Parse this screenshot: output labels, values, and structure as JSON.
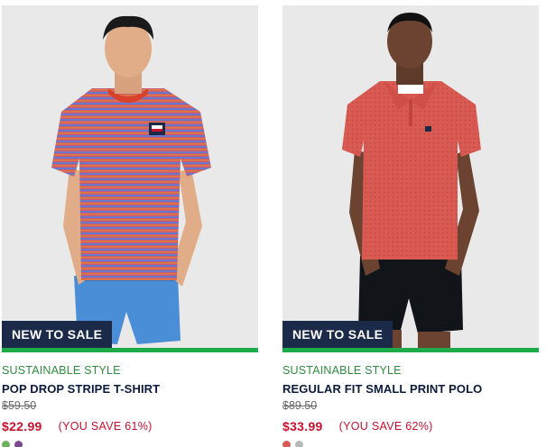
{
  "products": [
    {
      "badge": "NEW TO SALE",
      "tag": "SUSTAINABLE STYLE",
      "name": "POP DROP STRIPE T-SHIRT",
      "old_price": "$59.50",
      "new_price": "$22.99",
      "you_save": "(YOU SAVE 61%)",
      "swatches": [
        "#6fb05c",
        "#7a4b8f"
      ]
    },
    {
      "badge": "NEW TO SALE",
      "tag": "SUSTAINABLE STYLE",
      "name": "REGULAR FIT SMALL PRINT POLO",
      "old_price": "$89.50",
      "new_price": "$33.99",
      "you_save": "(YOU SAVE 62%)",
      "swatches": [
        "#d95a52",
        "#b8b8b8"
      ]
    }
  ],
  "colors": {
    "badge_bg": "#1c2a4a",
    "accent_green": "#1faa4a",
    "sale_red": "#c8102e",
    "name_navy": "#0b1b3d"
  }
}
